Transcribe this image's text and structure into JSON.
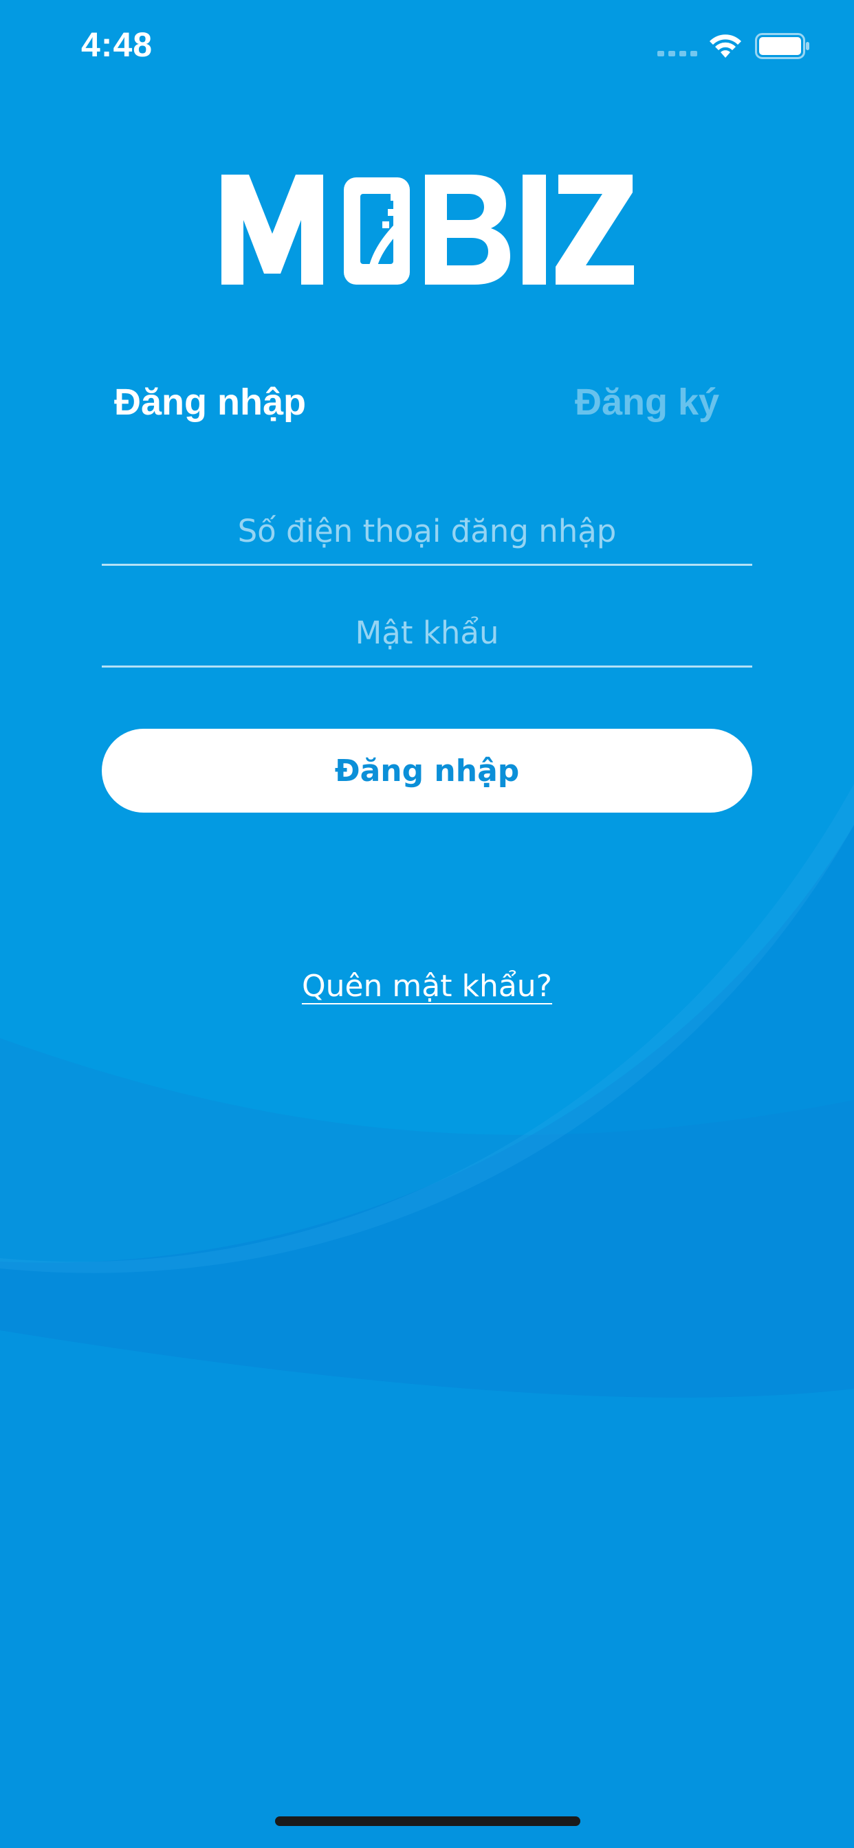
{
  "status_bar": {
    "time": "4:48"
  },
  "logo": {
    "text": "MOBIZ"
  },
  "tabs": [
    {
      "label": "Đăng nhập",
      "active": true
    },
    {
      "label": "Đăng ký",
      "active": false
    }
  ],
  "form": {
    "phone_placeholder": "Số điện thoại đăng nhập",
    "phone_value": "",
    "password_placeholder": "Mật khẩu",
    "password_value": "",
    "submit_label": "Đăng nhập"
  },
  "forgot_password": {
    "label": "Quên mật khẩu?"
  },
  "colors": {
    "background": "#039ae2",
    "wave": "#0d86d6",
    "button_text": "#0b8fd8",
    "text": "#ffffff"
  }
}
